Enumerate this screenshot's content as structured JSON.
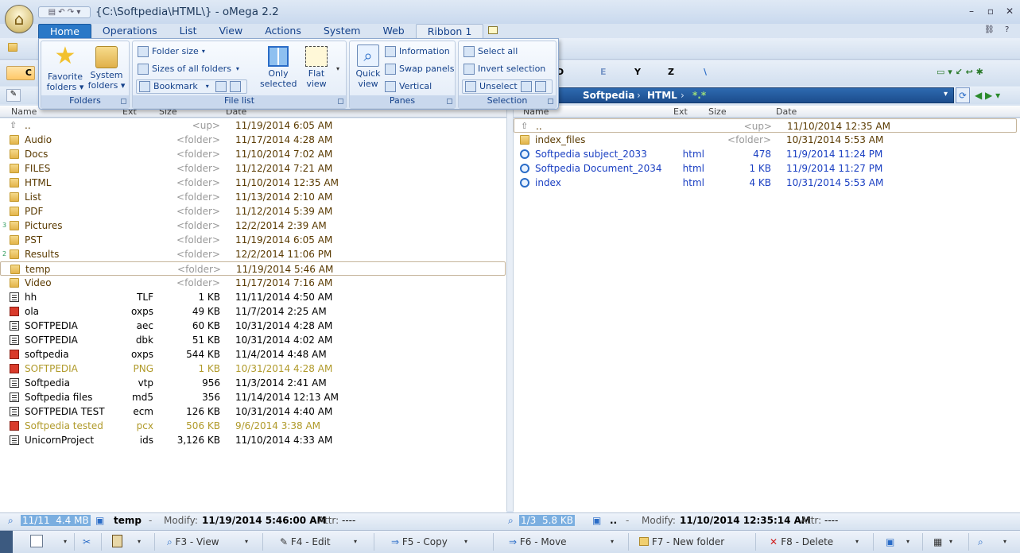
{
  "window": {
    "title": "{C:\\Softpedia\\HTML\\} - oMega 2.2",
    "app_glyph": "⌂",
    "qat_glyphs": "▤ ↶ ↷ ▾"
  },
  "tabs": [
    {
      "label": "Home",
      "active": true
    },
    {
      "label": "Operations"
    },
    {
      "label": "List"
    },
    {
      "label": "View"
    },
    {
      "label": "Actions"
    },
    {
      "label": "System"
    },
    {
      "label": "Web"
    },
    {
      "label": "Ribbon 1"
    }
  ],
  "ribbon": {
    "folders": {
      "caption": "Folders",
      "favorite": "Favorite\nfolders ▾",
      "system": "System\nfolders ▾"
    },
    "filelist": {
      "caption": "File list",
      "folder_size": "Folder size",
      "sizes_all": "Sizes of all folders",
      "bookmark": "Bookmark",
      "only_selected": "Only\nselected",
      "flat_view": "Flat\nview"
    },
    "panes": {
      "caption": "Panes",
      "quick_view": "Quick\nview",
      "information": "Information",
      "swap": "Swap panels",
      "vertical": "Vertical"
    },
    "selection": {
      "caption": "Selection",
      "select_all": "Select all",
      "invert": "Invert selection",
      "unselect": "Unselect"
    }
  },
  "drives_right": [
    "D",
    "E",
    "Y",
    "Z",
    "\\"
  ],
  "left_panel": {
    "drive_label": "C",
    "columns": {
      "name": "Name",
      "ext": "Ext",
      "size": "Size",
      "date": "Date"
    },
    "rows": [
      {
        "name": "..",
        "ext": "",
        "size": "<up>",
        "date": "11/19/2014 6:05 AM",
        "type": "up"
      },
      {
        "name": "Audio",
        "ext": "",
        "size": "<folder>",
        "date": "11/17/2014 4:28 AM",
        "type": "folder"
      },
      {
        "name": "Docs",
        "ext": "",
        "size": "<folder>",
        "date": "11/10/2014 7:02 AM",
        "type": "folder"
      },
      {
        "name": "FILES",
        "ext": "",
        "size": "<folder>",
        "date": "11/12/2014 7:21 AM",
        "type": "folder"
      },
      {
        "name": "HTML",
        "ext": "",
        "size": "<folder>",
        "date": "11/10/2014 12:35 AM",
        "type": "folder"
      },
      {
        "name": "List",
        "ext": "",
        "size": "<folder>",
        "date": "11/13/2014 2:10 AM",
        "type": "folder"
      },
      {
        "name": "PDF",
        "ext": "",
        "size": "<folder>",
        "date": "11/12/2014 5:39 AM",
        "type": "folder"
      },
      {
        "name": "Pictures",
        "ext": "",
        "size": "<folder>",
        "date": "12/2/2014 2:39 AM",
        "type": "folder",
        "mark": "3"
      },
      {
        "name": "PST",
        "ext": "",
        "size": "<folder>",
        "date": "11/19/2014 6:05 AM",
        "type": "folder"
      },
      {
        "name": "Results",
        "ext": "",
        "size": "<folder>",
        "date": "12/2/2014 11:06 PM",
        "type": "folder",
        "mark": "2"
      },
      {
        "name": "temp",
        "ext": "",
        "size": "<folder>",
        "date": "11/19/2014 5:46 AM",
        "type": "folder",
        "selected": true
      },
      {
        "name": "Video",
        "ext": "",
        "size": "<folder>",
        "date": "11/17/2014 7:16 AM",
        "type": "folder"
      },
      {
        "name": "hh",
        "ext": "TLF",
        "size": "1 KB",
        "date": "11/11/2014 4:50 AM",
        "type": "doc"
      },
      {
        "name": "ola",
        "ext": "oxps",
        "size": "49 KB",
        "date": "11/7/2014 2:25 AM",
        "type": "red"
      },
      {
        "name": "SOFTPEDIA",
        "ext": "aec",
        "size": "60 KB",
        "date": "10/31/2014 4:28 AM",
        "type": "doc"
      },
      {
        "name": "SOFTPEDIA",
        "ext": "dbk",
        "size": "51 KB",
        "date": "10/31/2014 4:02 AM",
        "type": "doc"
      },
      {
        "name": "softpedia",
        "ext": "oxps",
        "size": "544 KB",
        "date": "11/4/2014 4:48 AM",
        "type": "red"
      },
      {
        "name": "SOFTPEDIA",
        "ext": "PNG",
        "size": "1 KB",
        "date": "10/31/2014 4:28 AM",
        "type": "img",
        "color": "#b09a2a"
      },
      {
        "name": "Softpedia",
        "ext": "vtp",
        "size": "956",
        "date": "11/3/2014 2:41 AM",
        "type": "doc"
      },
      {
        "name": "Softpedia files",
        "ext": "md5",
        "size": "356",
        "date": "11/14/2014 12:13 AM",
        "type": "doc"
      },
      {
        "name": "SOFTPEDIA TEST",
        "ext": "ecm",
        "size": "126 KB",
        "date": "10/31/2014 4:40 AM",
        "type": "doc"
      },
      {
        "name": "Softpedia tested",
        "ext": "pcx",
        "size": "506 KB",
        "date": "9/6/2014 3:38 AM",
        "type": "img",
        "color": "#b09a2a"
      },
      {
        "name": "UnicornProject",
        "ext": "ids",
        "size": "3,126 KB",
        "date": "11/10/2014 4:33 AM",
        "type": "doc"
      }
    ],
    "status": {
      "count": "11/11",
      "size": "4.4 MB",
      "name": "temp",
      "dash": "-",
      "modify_label": "Modify:",
      "modify": "11/19/2014 5:46:00 AM",
      "attr_label": "Attr:",
      "attr": "----"
    }
  },
  "right_panel": {
    "path": [
      "Softpedia",
      "HTML",
      "*.*"
    ],
    "columns": {
      "name": "Name",
      "ext": "Ext",
      "size": "Size",
      "date": "Date"
    },
    "rows": [
      {
        "name": "..",
        "ext": "",
        "size": "<up>",
        "date": "11/10/2014 12:35 AM",
        "type": "up",
        "selected": true
      },
      {
        "name": "index_files",
        "ext": "",
        "size": "<folder>",
        "date": "10/31/2014 5:53 AM",
        "type": "folder"
      },
      {
        "name": "Softpedia subject_2033",
        "ext": "html",
        "size": "478",
        "date": "11/9/2014 11:24 PM",
        "type": "ie",
        "color": "#1a3fc2"
      },
      {
        "name": "Softpedia Document_2034",
        "ext": "html",
        "size": "1 KB",
        "date": "11/9/2014 11:27 PM",
        "type": "ie",
        "color": "#1a3fc2"
      },
      {
        "name": "index",
        "ext": "html",
        "size": "4 KB",
        "date": "10/31/2014 5:53 AM",
        "type": "ie",
        "color": "#1a3fc2"
      }
    ],
    "status": {
      "count": "1/3",
      "size": "5.8 KB",
      "name": "..",
      "dash": "-",
      "modify_label": "Modify:",
      "modify": "11/10/2014 12:35:14 AM",
      "attr_label": "Attr:",
      "attr": "----"
    }
  },
  "fnkeys": [
    {
      "label": "F3 - View"
    },
    {
      "label": "F4 - Edit"
    },
    {
      "label": "F5 - Copy"
    },
    {
      "label": "F6 - Move"
    },
    {
      "label": "F7 - New folder"
    },
    {
      "label": "F8 - Delete"
    }
  ],
  "colors": {
    "folder_text": "#5a3a00",
    "muted": "#999999",
    "accent": "#2a78c7",
    "link_blue": "#1a3fc2",
    "olive": "#b09a2a"
  }
}
